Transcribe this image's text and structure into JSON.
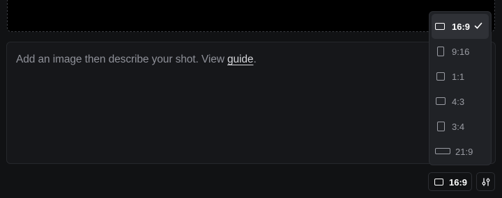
{
  "prompt": {
    "text_before": "Add an image then describe your shot. View ",
    "link_text": "guide",
    "text_after": "."
  },
  "aspect_menu": {
    "selected": "16:9",
    "items": [
      {
        "label": "16:9",
        "icon": "landscape-rect-icon"
      },
      {
        "label": "9:16",
        "icon": "portrait-rect-icon"
      },
      {
        "label": "1:1",
        "icon": "square-icon"
      },
      {
        "label": "4:3",
        "icon": "landscape-rect-icon"
      },
      {
        "label": "3:4",
        "icon": "portrait-rect-icon"
      },
      {
        "label": "21:9",
        "icon": "wide-rect-icon"
      }
    ]
  },
  "toolbar": {
    "aspect_label": "16:9",
    "settings_icon": "sliders-icon"
  },
  "colors": {
    "background": "#111214",
    "menu_background": "#202226",
    "selected_item": "#2f3136"
  }
}
